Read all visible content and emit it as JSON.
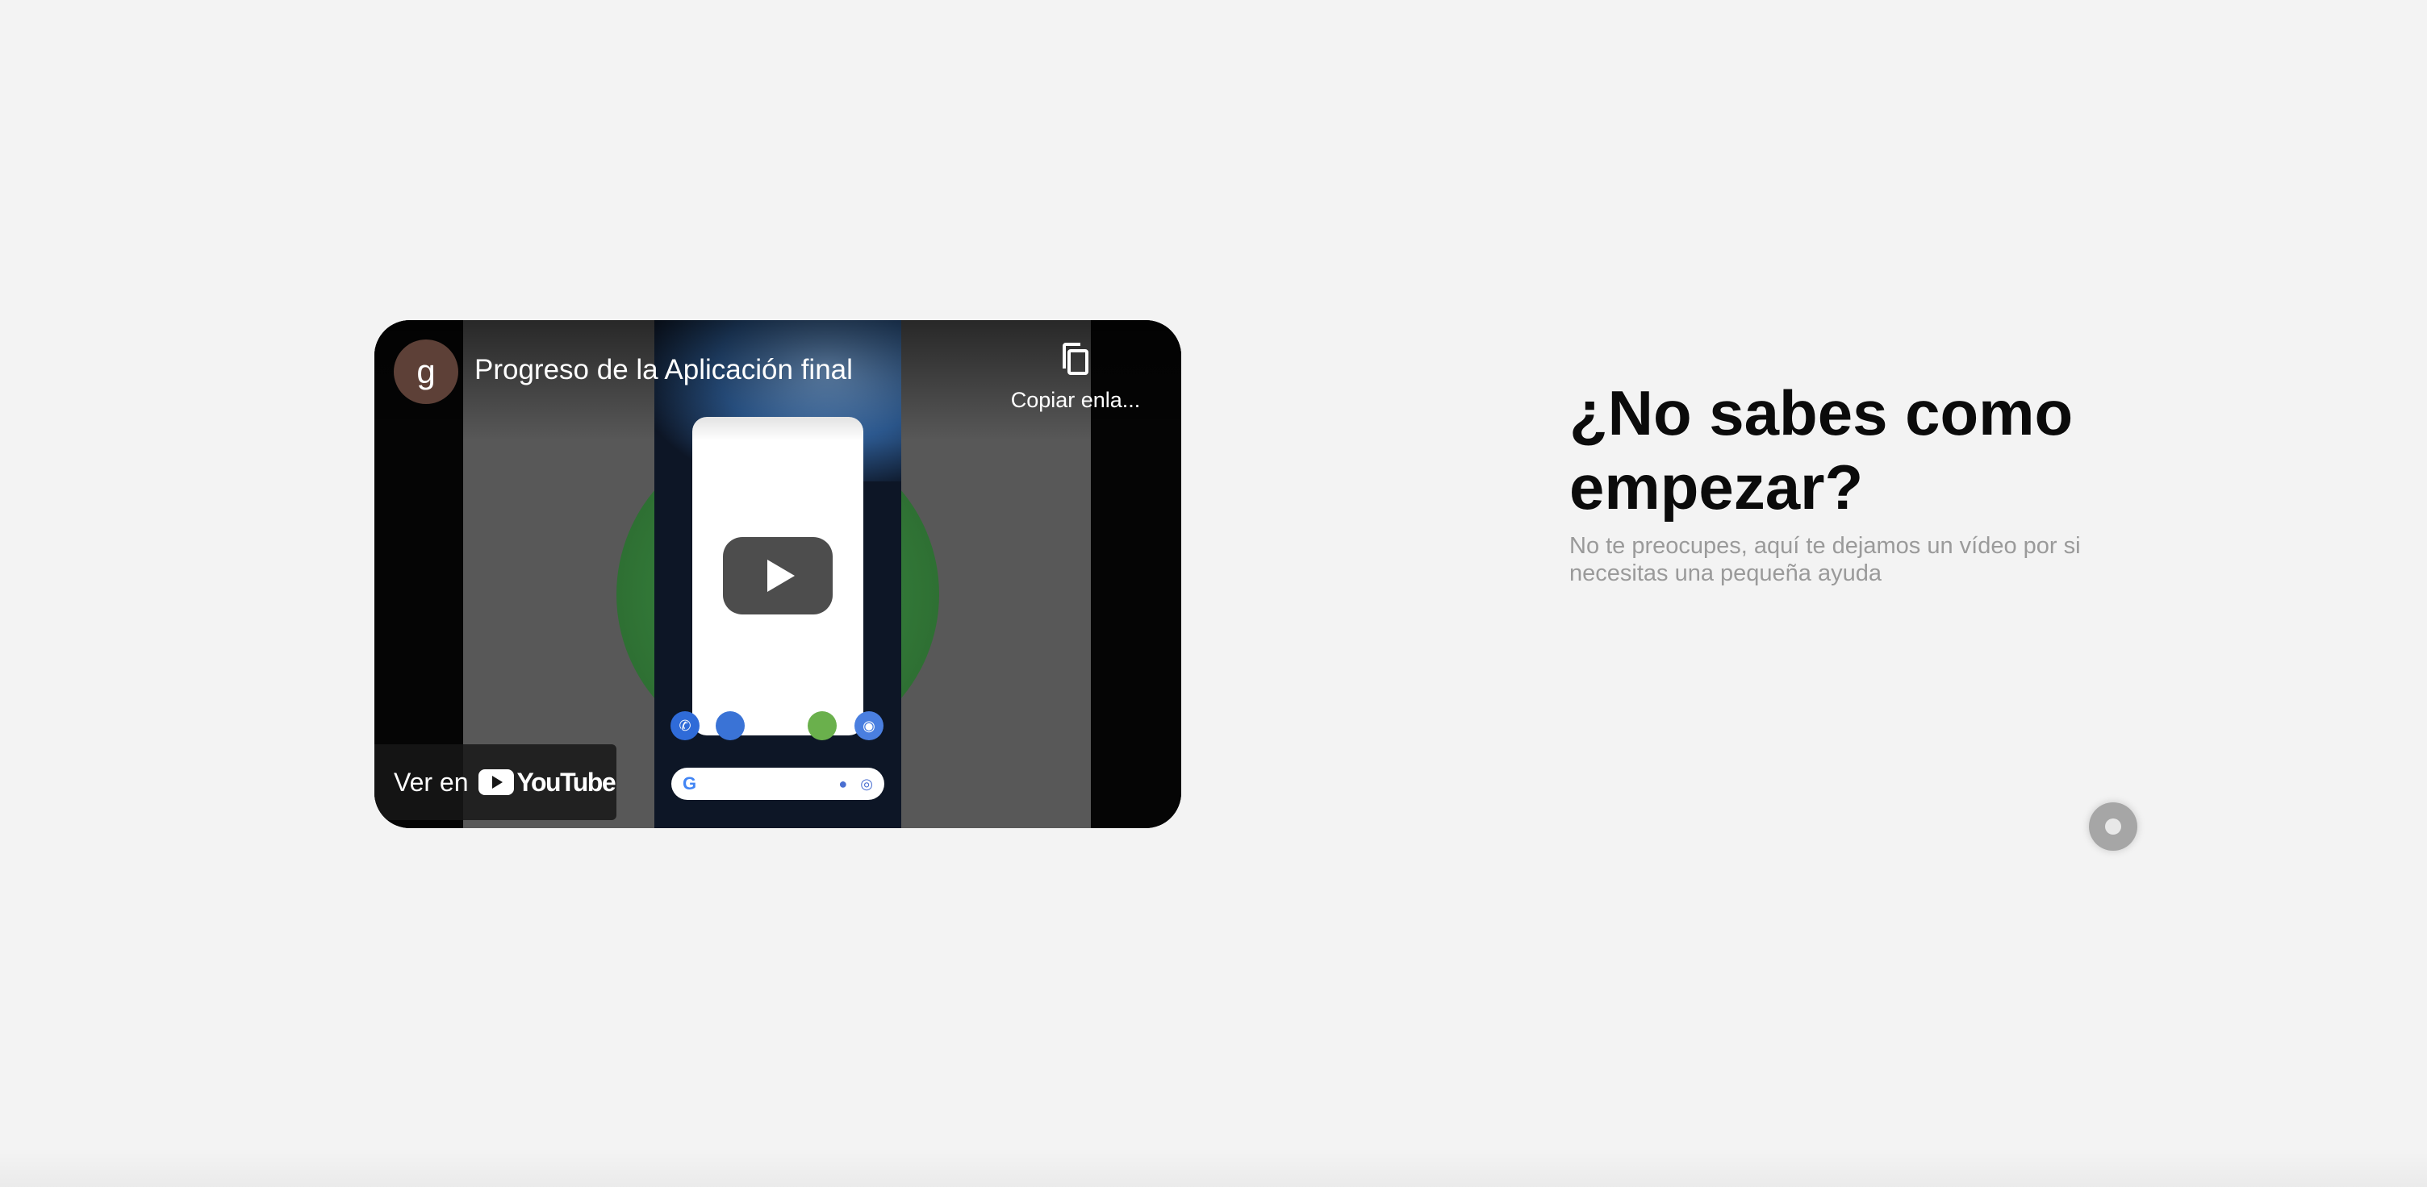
{
  "video": {
    "channel_initial": "g",
    "title": "Progreso de la Aplicación final",
    "copy_link_label": "Copiar enla...",
    "watch_on_label": "Ver en",
    "youtube_wordmark": "YouTube",
    "play_icon": "play-icon",
    "copy_icon": "copy-icon"
  },
  "intro": {
    "heading": "¿No sabes como empezar?",
    "subtitle": "No te preocupes, aquí te dejamos un vídeo por si necesitas una pequeña ayuda"
  },
  "colors": {
    "background": "#f3f3f3",
    "heading": "#0b0b0b",
    "subtitle": "#9a9a9a",
    "avatar": "#5d4037"
  }
}
